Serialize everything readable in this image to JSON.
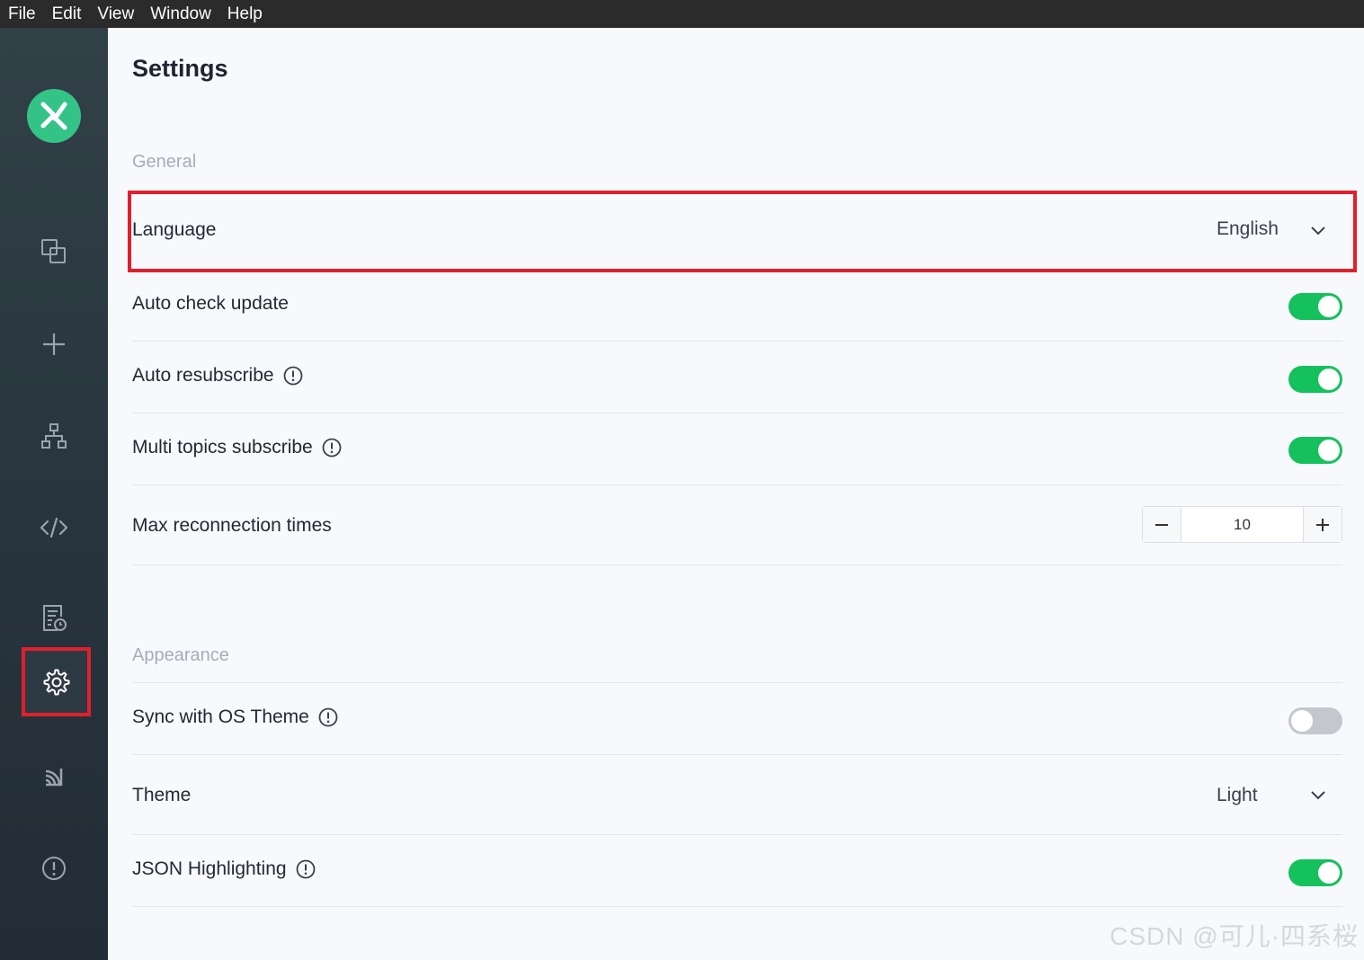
{
  "menubar": {
    "items": [
      "File",
      "Edit",
      "View",
      "Window",
      "Help"
    ]
  },
  "sidebar": {
    "logo_icon": "mqttx-logo-icon",
    "items": [
      {
        "name": "connections",
        "icon": "connections-icon"
      },
      {
        "name": "new-connection",
        "icon": "plus-icon"
      },
      {
        "name": "topology",
        "icon": "network-icon"
      },
      {
        "name": "script",
        "icon": "code-icon"
      },
      {
        "name": "log",
        "icon": "log-icon"
      },
      {
        "name": "settings",
        "icon": "gear-icon",
        "active": true
      },
      {
        "name": "feed",
        "icon": "rss-icon"
      },
      {
        "name": "about",
        "icon": "info-icon"
      }
    ]
  },
  "page": {
    "title": "Settings"
  },
  "general": {
    "section_title": "General",
    "language_label": "Language",
    "language_value": "English",
    "auto_check_update_label": "Auto check update",
    "auto_check_update_on": true,
    "auto_resubscribe_label": "Auto resubscribe",
    "auto_resubscribe_on": true,
    "multi_topics_label": "Multi topics subscribe",
    "multi_topics_on": true,
    "max_reconnect_label": "Max reconnection times",
    "max_reconnect_value": "10"
  },
  "appearance": {
    "section_title": "Appearance",
    "sync_os_label": "Sync with OS Theme",
    "sync_os_on": false,
    "theme_label": "Theme",
    "theme_value": "Light",
    "json_highlight_label": "JSON Highlighting",
    "json_highlight_on": true
  },
  "colors": {
    "accent": "#15c15d",
    "highlight": "#e0202c",
    "sidebar": "#2a3740"
  },
  "watermark": "CSDN @可儿·四系桜"
}
